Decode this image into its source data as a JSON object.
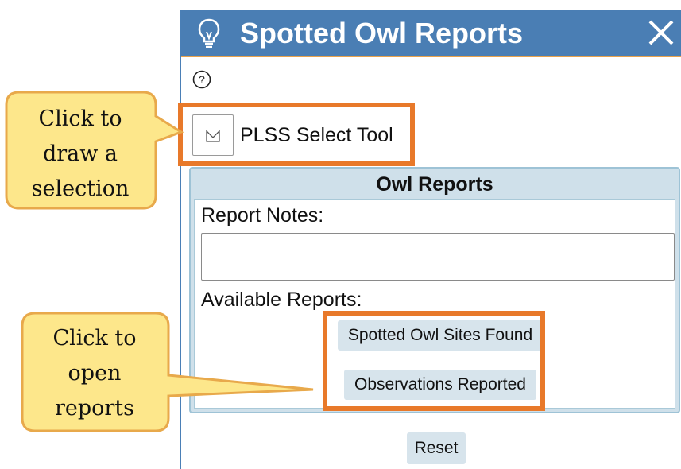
{
  "window": {
    "title": "Spotted Owl Reports",
    "icon": "lightbulb-icon",
    "close_icon": "close-icon",
    "header_color": "#4a7eb4"
  },
  "help": {
    "icon": "help-icon",
    "glyph": "?"
  },
  "tool": {
    "label": "PLSS Select Tool",
    "icon": "polygon-select-icon"
  },
  "owl_reports": {
    "title": "Owl Reports",
    "notes_label": "Report Notes:",
    "notes_value": "",
    "available_label": "Available Reports:",
    "buttons": [
      "Spotted Owl Sites Found",
      "Observations Reported"
    ]
  },
  "reset_label": "Reset",
  "annotations": {
    "callout_1": [
      "Click to",
      "draw a",
      "selection"
    ],
    "callout_2": [
      "Click to",
      "open",
      "reports"
    ],
    "highlight_color": "#e8792a",
    "callout_fill": "#fde78b"
  }
}
